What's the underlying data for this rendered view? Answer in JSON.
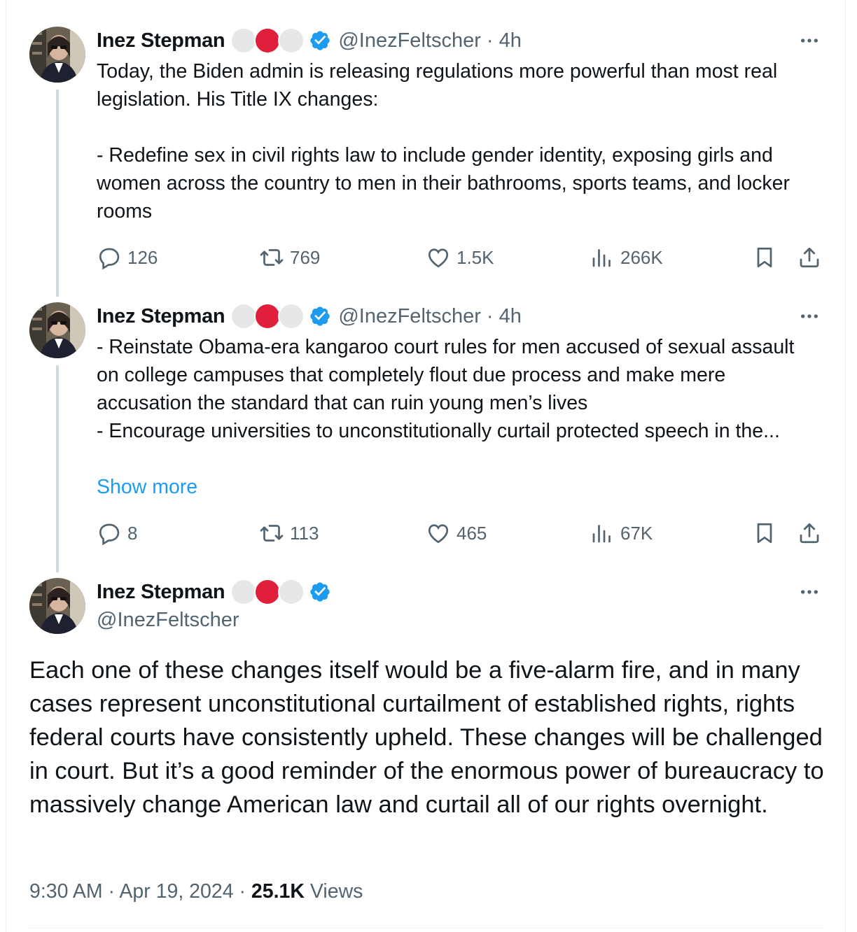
{
  "colors": {
    "accent": "#1d9bf0",
    "secondary_text": "#536471",
    "primary_text": "#0f1419",
    "dot_red": "#e0203a",
    "dot_grey": "#e6e7e8"
  },
  "tweets": [
    {
      "name": "Inez Stepman",
      "handle": "@InezFeltscher",
      "time": "· 4h",
      "text": "Today, the Biden admin is releasing regulations more powerful than most real legislation. His Title IX changes:\n\n- Redefine sex in civil rights law to include gender identity, exposing girls and women across the country to men in their bathrooms, sports teams, and locker rooms",
      "replies": "126",
      "reposts": "769",
      "likes": "1.5K",
      "views": "266K"
    },
    {
      "name": "Inez Stepman",
      "handle": "@InezFeltscher",
      "time": "· 4h",
      "text": "- Reinstate Obama-era kangaroo court rules for men accused of sexual assault on college campuses that completely flout due process and make mere accusation the standard that can ruin young men’s lives\n- Encourage universities to unconstitutionally curtail protected speech in the...",
      "show_more": "Show more",
      "replies": "8",
      "reposts": "113",
      "likes": "465",
      "views": "67K"
    }
  ],
  "main_tweet": {
    "name": "Inez Stepman",
    "handle": "@InezFeltscher",
    "text": "Each one of these changes itself would be a five-alarm fire, and in many cases represent unconstitutional curtailment of established rights, rights federal courts have consistently upheld. These changes will be challenged in court. But it’s a good reminder of the enormous power of bureaucracy to massively change American law and curtail all of our rights overnight.",
    "time": "9:30 AM",
    "date": "Apr 19, 2024",
    "views_count": "25.1K",
    "views_label": "Views"
  },
  "icons": [
    "avatar",
    "grey-dot-icon",
    "red-dot-icon",
    "verified-badge-icon",
    "more-icon",
    "reply-icon",
    "repost-icon",
    "like-icon",
    "views-icon",
    "bookmark-icon",
    "share-icon"
  ]
}
